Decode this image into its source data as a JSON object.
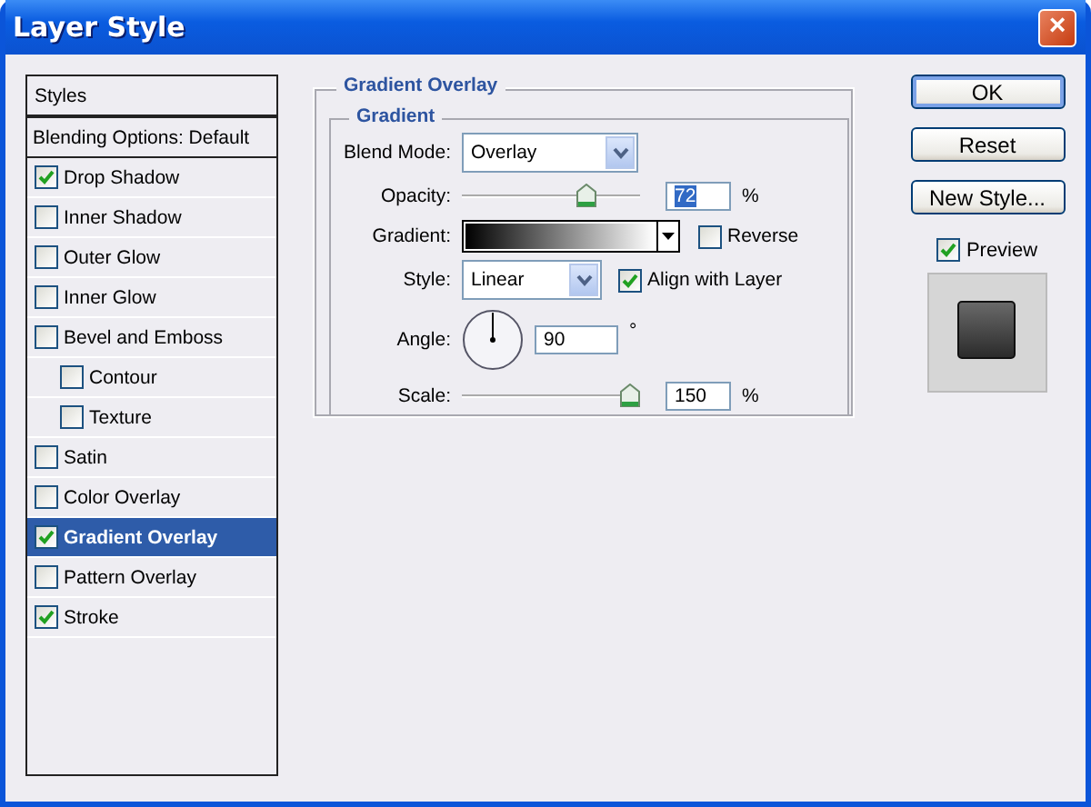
{
  "window": {
    "title": "Layer Style",
    "close_label": "×"
  },
  "styles_panel": {
    "header": "Styles",
    "items": [
      {
        "label": "Blending Options: Default",
        "kind": "plain",
        "selected": false
      },
      {
        "label": "Drop Shadow",
        "kind": "check",
        "checked": true,
        "selected": false
      },
      {
        "label": "Inner Shadow",
        "kind": "check",
        "checked": false,
        "selected": false
      },
      {
        "label": "Outer Glow",
        "kind": "check",
        "checked": false,
        "selected": false
      },
      {
        "label": "Inner Glow",
        "kind": "check",
        "checked": false,
        "selected": false
      },
      {
        "label": "Bevel and Emboss",
        "kind": "check",
        "checked": false,
        "selected": false,
        "children": [
          {
            "label": "Contour",
            "kind": "check",
            "checked": false,
            "selected": false
          },
          {
            "label": "Texture",
            "kind": "check",
            "checked": false,
            "selected": false
          }
        ]
      },
      {
        "label": "Satin",
        "kind": "check",
        "checked": false,
        "selected": false
      },
      {
        "label": "Color Overlay",
        "kind": "check",
        "checked": false,
        "selected": false
      },
      {
        "label": "Gradient Overlay",
        "kind": "check",
        "checked": true,
        "selected": true
      },
      {
        "label": "Pattern Overlay",
        "kind": "check",
        "checked": false,
        "selected": false
      },
      {
        "label": "Stroke",
        "kind": "check",
        "checked": true,
        "selected": false
      }
    ]
  },
  "gradient_overlay": {
    "title": "Gradient Overlay",
    "group_title": "Gradient",
    "blend_mode": {
      "label": "Blend Mode:",
      "value": "Overlay"
    },
    "opacity": {
      "label": "Opacity:",
      "level": 0.72,
      "value": "72",
      "value_highlighted": true,
      "unit": "%"
    },
    "gradient": {
      "label": "Gradient:"
    },
    "reverse": {
      "label": "Reverse",
      "checked": false
    },
    "style": {
      "label": "Style:",
      "value": "Linear"
    },
    "align_with_layer": {
      "label": "Align with Layer",
      "checked": true
    },
    "angle": {
      "label": "Angle:",
      "value": "90",
      "unit": "°"
    },
    "scale": {
      "label": "Scale:",
      "level": 1,
      "value": "150",
      "unit": "%"
    }
  },
  "buttons": [
    {
      "label": "OK",
      "default": true
    },
    {
      "label": "Reset",
      "default": false
    },
    {
      "label": "New Style...",
      "default": false
    }
  ],
  "preview": {
    "label": "Preview",
    "checked": true
  }
}
